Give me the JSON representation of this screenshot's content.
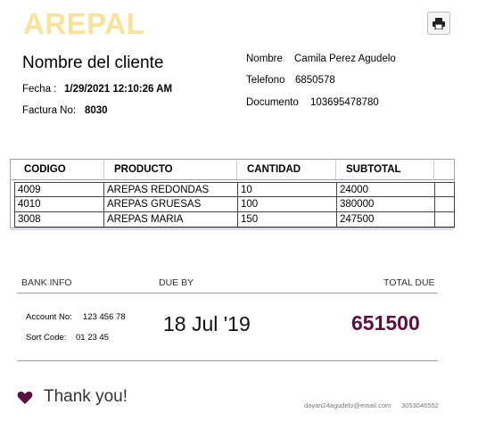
{
  "brand": {
    "logo_text": "AREPAL",
    "logo_color": "#f7e39a"
  },
  "toolbar": {
    "print_icon": "print-icon"
  },
  "client": {
    "title": "Nombre del cliente",
    "fecha_label": "Fecha :",
    "fecha_value": "1/29/2021 12:10:26 AM",
    "factura_label": "Factura No:",
    "factura_value": "8030",
    "nombre_label": "Nombre",
    "nombre_value": "Camila Perez Agudelo",
    "telefono_label": "Telefono",
    "telefono_value": "6850578",
    "documento_label": "Documento",
    "documento_value": "103695478780"
  },
  "table": {
    "headers": [
      "CODIGO",
      "PRODUCTO",
      "CANTIDAD",
      "SUBTOTAL"
    ],
    "rows": [
      [
        "4009",
        "AREPAS REDONDAS",
        "10",
        "24000"
      ],
      [
        "4010",
        "AREPAS GRUESAS",
        "100",
        "380000"
      ],
      [
        "3008",
        "AREPAS MARIA",
        "150",
        "247500"
      ]
    ]
  },
  "footer": {
    "bank_info_label": "BANK INFO",
    "due_by_label": "DUE BY",
    "total_due_label": "TOTAL DUE",
    "account_label": "Account No:",
    "account_value": "123 456 78",
    "sort_label": "Sort Code:",
    "sort_value": "01 23 45",
    "due_date": "18 Jul '19",
    "total_due": "651500",
    "total_color": "#5a0f42",
    "thanks": "Thank you!",
    "heart_icon": "heart-icon",
    "heart_color": "#5a0f42",
    "email": "dayan24agudelo@email.com",
    "phone": "3053046552"
  }
}
